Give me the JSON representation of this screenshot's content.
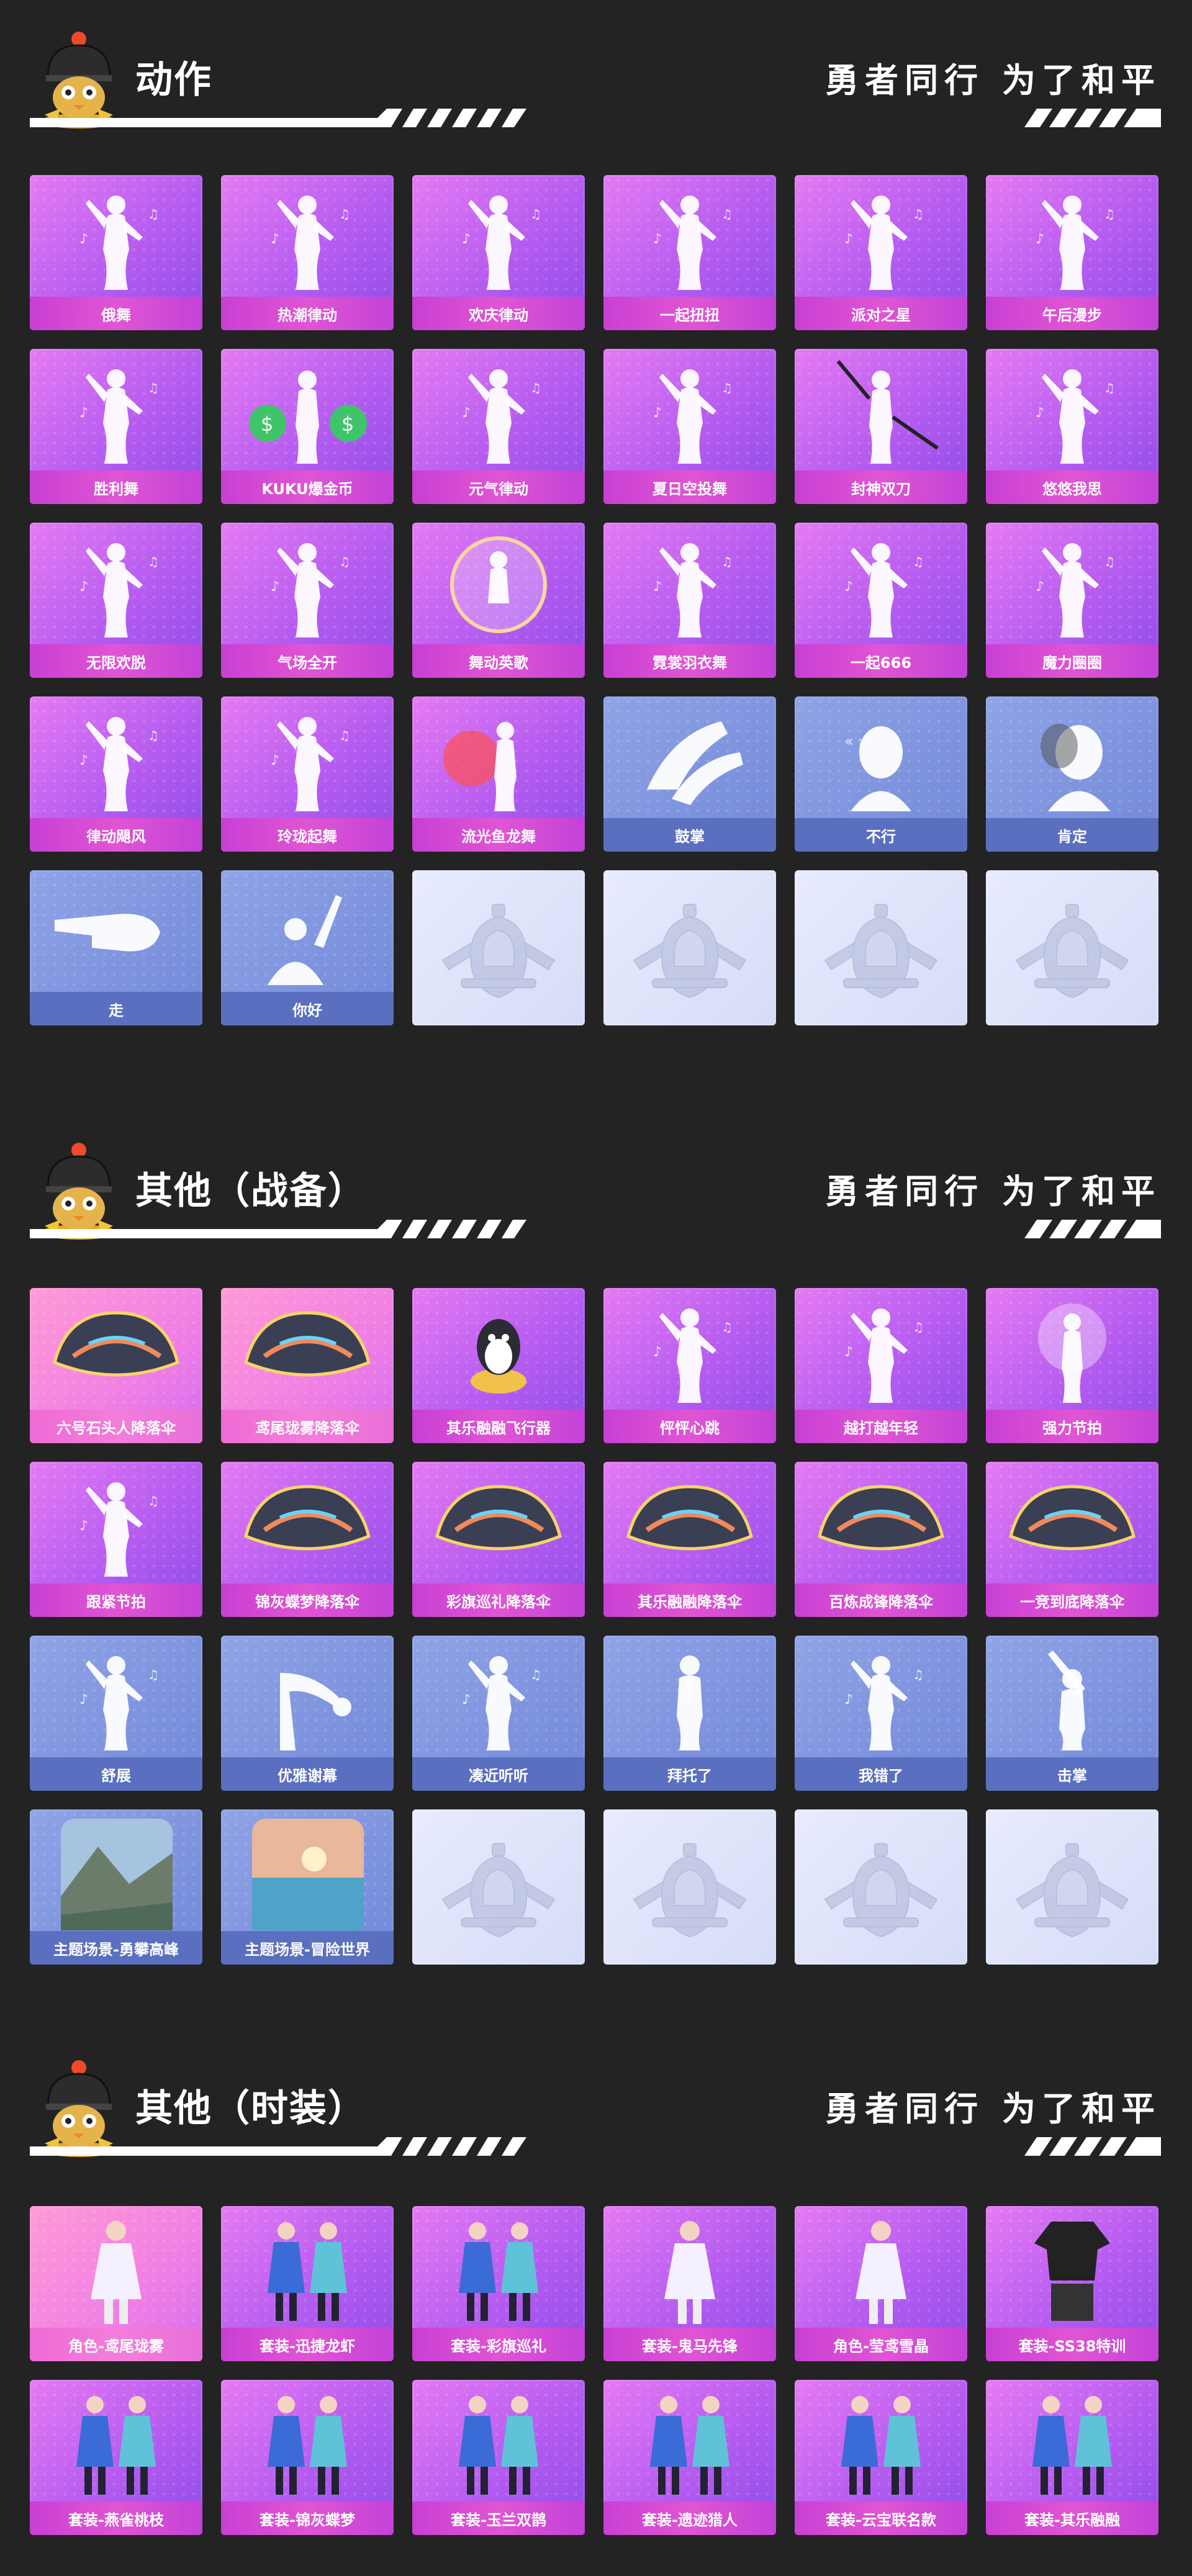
{
  "slogan": "勇者同行 为了和平",
  "colors": {
    "background": "#232323",
    "purple_card": "#b55cf0",
    "pink_card": "#f07fe4",
    "blue_card": "#7389d8",
    "empty_card": "#e2e6fb"
  },
  "sections": [
    {
      "title": "动作",
      "items": [
        {
          "label": "俄舞",
          "style": "purple",
          "icon": "dancer-silhouette-icon"
        },
        {
          "label": "热潮律动",
          "style": "purple",
          "icon": "dancer-silhouette-icon"
        },
        {
          "label": "欢庆律动",
          "style": "purple",
          "icon": "dancer-silhouette-icon"
        },
        {
          "label": "一起扭扭",
          "style": "purple",
          "icon": "dancer-silhouette-icon"
        },
        {
          "label": "派对之星",
          "style": "purple",
          "icon": "dancer-silhouette-icon"
        },
        {
          "label": "午后漫步",
          "style": "purple",
          "icon": "dancer-silhouette-icon"
        },
        {
          "label": "胜利舞",
          "style": "purple",
          "icon": "dancer-silhouette-icon"
        },
        {
          "label": "KUKU爆金币",
          "style": "purple",
          "icon": "money-bag-dancer-icon"
        },
        {
          "label": "元气律动",
          "style": "purple",
          "icon": "dancer-silhouette-icon"
        },
        {
          "label": "夏日空投舞",
          "style": "purple",
          "icon": "dancer-silhouette-icon"
        },
        {
          "label": "封神双刀",
          "style": "purple",
          "icon": "sword-dancer-icon"
        },
        {
          "label": "悠悠我思",
          "style": "purple",
          "icon": "dancer-silhouette-icon"
        },
        {
          "label": "无限欢脱",
          "style": "purple",
          "icon": "dancer-silhouette-icon"
        },
        {
          "label": "气场全开",
          "style": "purple",
          "icon": "dancer-silhouette-icon"
        },
        {
          "label": "舞动英歌",
          "style": "purple",
          "icon": "bubble-dancer-icon"
        },
        {
          "label": "霓裳羽衣舞",
          "style": "purple",
          "icon": "dancer-silhouette-icon"
        },
        {
          "label": "一起666",
          "style": "purple",
          "icon": "dancer-silhouette-icon"
        },
        {
          "label": "魔力圈圈",
          "style": "purple",
          "icon": "dancer-silhouette-icon"
        },
        {
          "label": "律动飓风",
          "style": "purple",
          "icon": "dancer-silhouette-icon"
        },
        {
          "label": "玲珑起舞",
          "style": "purple",
          "icon": "dancer-silhouette-icon"
        },
        {
          "label": "流光鱼龙舞",
          "style": "purple",
          "icon": "dragon-dancer-icon"
        },
        {
          "label": "鼓掌",
          "style": "blue",
          "icon": "clapping-hands-icon"
        },
        {
          "label": "不行",
          "style": "blue",
          "icon": "head-shake-icon"
        },
        {
          "label": "肯定",
          "style": "blue",
          "icon": "head-nod-icon"
        },
        {
          "label": "走",
          "style": "blue",
          "icon": "pointing-hand-icon"
        },
        {
          "label": "你好",
          "style": "blue",
          "icon": "waving-person-icon"
        },
        {
          "label": "",
          "style": "empty",
          "icon": "pubg-emblem-icon"
        },
        {
          "label": "",
          "style": "empty",
          "icon": "pubg-emblem-icon"
        },
        {
          "label": "",
          "style": "empty",
          "icon": "pubg-emblem-icon"
        },
        {
          "label": "",
          "style": "empty",
          "icon": "pubg-emblem-icon"
        }
      ]
    },
    {
      "title": "其他（战备）",
      "items": [
        {
          "label": "六号石头人降落伞",
          "style": "pink",
          "icon": "parachute-icon"
        },
        {
          "label": "鸢尾珑雾降落伞",
          "style": "pink",
          "icon": "parachute-icon"
        },
        {
          "label": "其乐融融飞行器",
          "style": "purple",
          "icon": "penguin-glider-icon"
        },
        {
          "label": "怦怦心跳",
          "style": "purple",
          "icon": "dancer-silhouette-icon"
        },
        {
          "label": "越打越年轻",
          "style": "purple",
          "icon": "dancer-silhouette-icon"
        },
        {
          "label": "强力节拍",
          "style": "purple",
          "icon": "glowing-dancer-icon"
        },
        {
          "label": "跟紧节拍",
          "style": "purple",
          "icon": "dancer-silhouette-icon"
        },
        {
          "label": "锦灰蝶梦降落伞",
          "style": "purple",
          "icon": "parachute-icon"
        },
        {
          "label": "彩旗巡礼降落伞",
          "style": "purple",
          "icon": "parachute-icon"
        },
        {
          "label": "其乐融融降落伞",
          "style": "purple",
          "icon": "parachute-icon"
        },
        {
          "label": "百炼成锋降落伞",
          "style": "purple",
          "icon": "parachute-icon"
        },
        {
          "label": "一竞到底降落伞",
          "style": "purple",
          "icon": "parachute-icon"
        },
        {
          "label": "舒展",
          "style": "blue",
          "icon": "dancer-silhouette-icon"
        },
        {
          "label": "优雅谢幕",
          "style": "blue",
          "icon": "bowing-person-icon"
        },
        {
          "label": "凑近听听",
          "style": "blue",
          "icon": "dancer-silhouette-icon"
        },
        {
          "label": "拜托了",
          "style": "blue",
          "icon": "praying-person-icon"
        },
        {
          "label": "我错了",
          "style": "blue",
          "icon": "dancer-silhouette-icon"
        },
        {
          "label": "击掌",
          "style": "blue",
          "icon": "high-five-icon"
        },
        {
          "label": "主题场景-勇攀高峰",
          "style": "blue",
          "icon": "mountain-scene-icon"
        },
        {
          "label": "主题场景-冒险世界",
          "style": "blue",
          "icon": "sea-scene-icon"
        },
        {
          "label": "",
          "style": "empty",
          "icon": "pubg-emblem-icon"
        },
        {
          "label": "",
          "style": "empty",
          "icon": "pubg-emblem-icon"
        },
        {
          "label": "",
          "style": "empty",
          "icon": "pubg-emblem-icon"
        },
        {
          "label": "",
          "style": "empty",
          "icon": "pubg-emblem-icon"
        }
      ]
    },
    {
      "title": "其他（时装）",
      "items": [
        {
          "label": "角色-鸢尾珑雾",
          "style": "pink",
          "icon": "outfit-character-icon"
        },
        {
          "label": "套装-迅捷龙虾",
          "style": "purple",
          "icon": "outfit-pair-icon"
        },
        {
          "label": "套装-彩旗巡礼",
          "style": "purple",
          "icon": "outfit-pair-icon"
        },
        {
          "label": "套装-鬼马先锋",
          "style": "purple",
          "icon": "outfit-character-icon"
        },
        {
          "label": "角色-莹鸢雪晶",
          "style": "purple",
          "icon": "outfit-character-icon"
        },
        {
          "label": "套装-SS38特训",
          "style": "purple",
          "icon": "outfit-clothes-icon"
        },
        {
          "label": "套装-燕雀桃枝",
          "style": "purple",
          "icon": "outfit-pair-icon"
        },
        {
          "label": "套装-锦灰蝶梦",
          "style": "purple",
          "icon": "outfit-pair-icon"
        },
        {
          "label": "套装-玉兰双鹊",
          "style": "purple",
          "icon": "outfit-pair-icon"
        },
        {
          "label": "套装-遗迹猎人",
          "style": "purple",
          "icon": "outfit-pair-icon"
        },
        {
          "label": "套装-云宝联名款",
          "style": "purple",
          "icon": "outfit-pair-icon"
        },
        {
          "label": "套装-其乐融融",
          "style": "purple",
          "icon": "outfit-pair-icon"
        }
      ]
    }
  ]
}
